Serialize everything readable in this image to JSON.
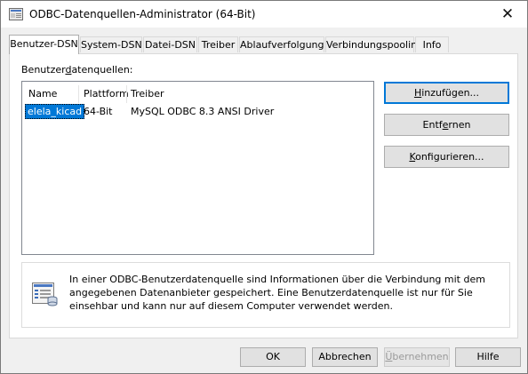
{
  "window": {
    "title": "ODBC-Datenquellen-Administrator (64-Bit)",
    "close_glyph": "✕"
  },
  "tabs": [
    {
      "label": "Benutzer-DSN",
      "active": true
    },
    {
      "label": "System-DSN"
    },
    {
      "label": "Datei-DSN"
    },
    {
      "label": "Treiber"
    },
    {
      "label": "Ablaufverfolgung"
    },
    {
      "label": "Verbindungspooling"
    },
    {
      "label": "Info"
    }
  ],
  "list": {
    "label_pre": "Benutzer",
    "label_mnemonic": "d",
    "label_post": "atenquellen:",
    "columns": [
      "Name",
      "Plattform",
      "Treiber"
    ],
    "rows": [
      {
        "name": "elela_kicad",
        "platform": "64-Bit",
        "driver": "MySQL ODBC 8.3 ANSI Driver"
      }
    ]
  },
  "buttons": {
    "add": {
      "mnemonic": "H",
      "rest": "inzufügen..."
    },
    "remove": {
      "pre": "Entf",
      "mnemonic": "e",
      "post": "rnen"
    },
    "configure": {
      "mnemonic": "K",
      "rest": "onfigurieren..."
    }
  },
  "info": {
    "text": "In einer ODBC-Benutzerdatenquelle sind Informationen über die Verbindung mit dem angegebenen Datenanbieter gespeichert. Eine Benutzerdatenquelle ist nur für Sie einsehbar und kann nur auf diesem Computer verwendet werden."
  },
  "footer": {
    "ok": "OK",
    "cancel": "Abbrechen",
    "apply_mnemonic": "Ü",
    "apply_rest": "bernehmen",
    "help": "Hilfe"
  },
  "colors": {
    "accent": "#0078d7",
    "selection": "#0078d7"
  },
  "icons": {
    "app": "odbc-app-icon",
    "info": "database-list-icon",
    "close": "close-icon"
  }
}
